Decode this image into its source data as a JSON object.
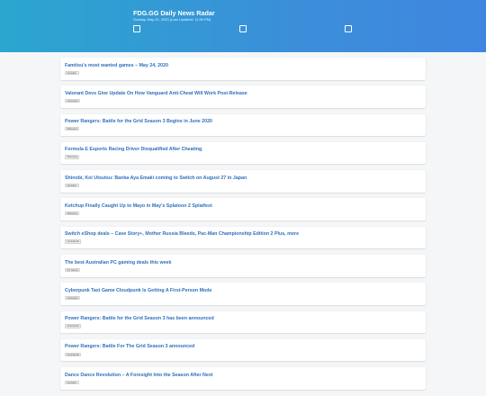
{
  "header": {
    "title": "FDG.GG Daily News Radar",
    "subtitle": "Sunday, May 24, 2020 (Last Updated: 11:59 PM)"
  },
  "articles": [
    {
      "title": "Famitsu's most wanted games – May 24, 2020",
      "source": "Gematsu"
    },
    {
      "title": "Valorant Devs Give Update On How Vanguard Anti-Cheat Will Work Post-Release",
      "source": "Gamespot"
    },
    {
      "title": "Power Rangers: Battle for the Grid Season 3 Begins in June 2020",
      "source": "Siliconera"
    },
    {
      "title": "Formula E Esports Racing Driver Disqualified After Cheating",
      "source": "Siliconera"
    },
    {
      "title": "Shinobi, Koi Utsutsu: Banka Aya Emaki coming to Switch on August 27 in Japan",
      "source": "Gematsu"
    },
    {
      "title": "Ketchup Finally Caught Up to Mayo in May's Splatoon 2 Splatfest",
      "source": "Siliconera"
    },
    {
      "title": "Switch eShop deals – Cave Story+, Mother Russia Bleeds, Pac-Man Championship Edition 2 Plus, more",
      "source": "Gonintendo"
    },
    {
      "title": "The best Australian PC gaming deals this week",
      "source": "PC Gamer"
    },
    {
      "title": "Cyberpunk Taxi Game Cloudpunk Is Getting A First-Person Mode",
      "source": "Gamespot"
    },
    {
      "title": "Power Rangers: Battle for the Grid Season 3 has been announced",
      "source": "Destructoid"
    },
    {
      "title": "Power Rangers: Battle For The Grid Season 3 announced",
      "source": "Gonintendo"
    },
    {
      "title": "Dance Dance Revolution – A Foresight Into the Season After Next",
      "source": "Gematsu"
    }
  ]
}
